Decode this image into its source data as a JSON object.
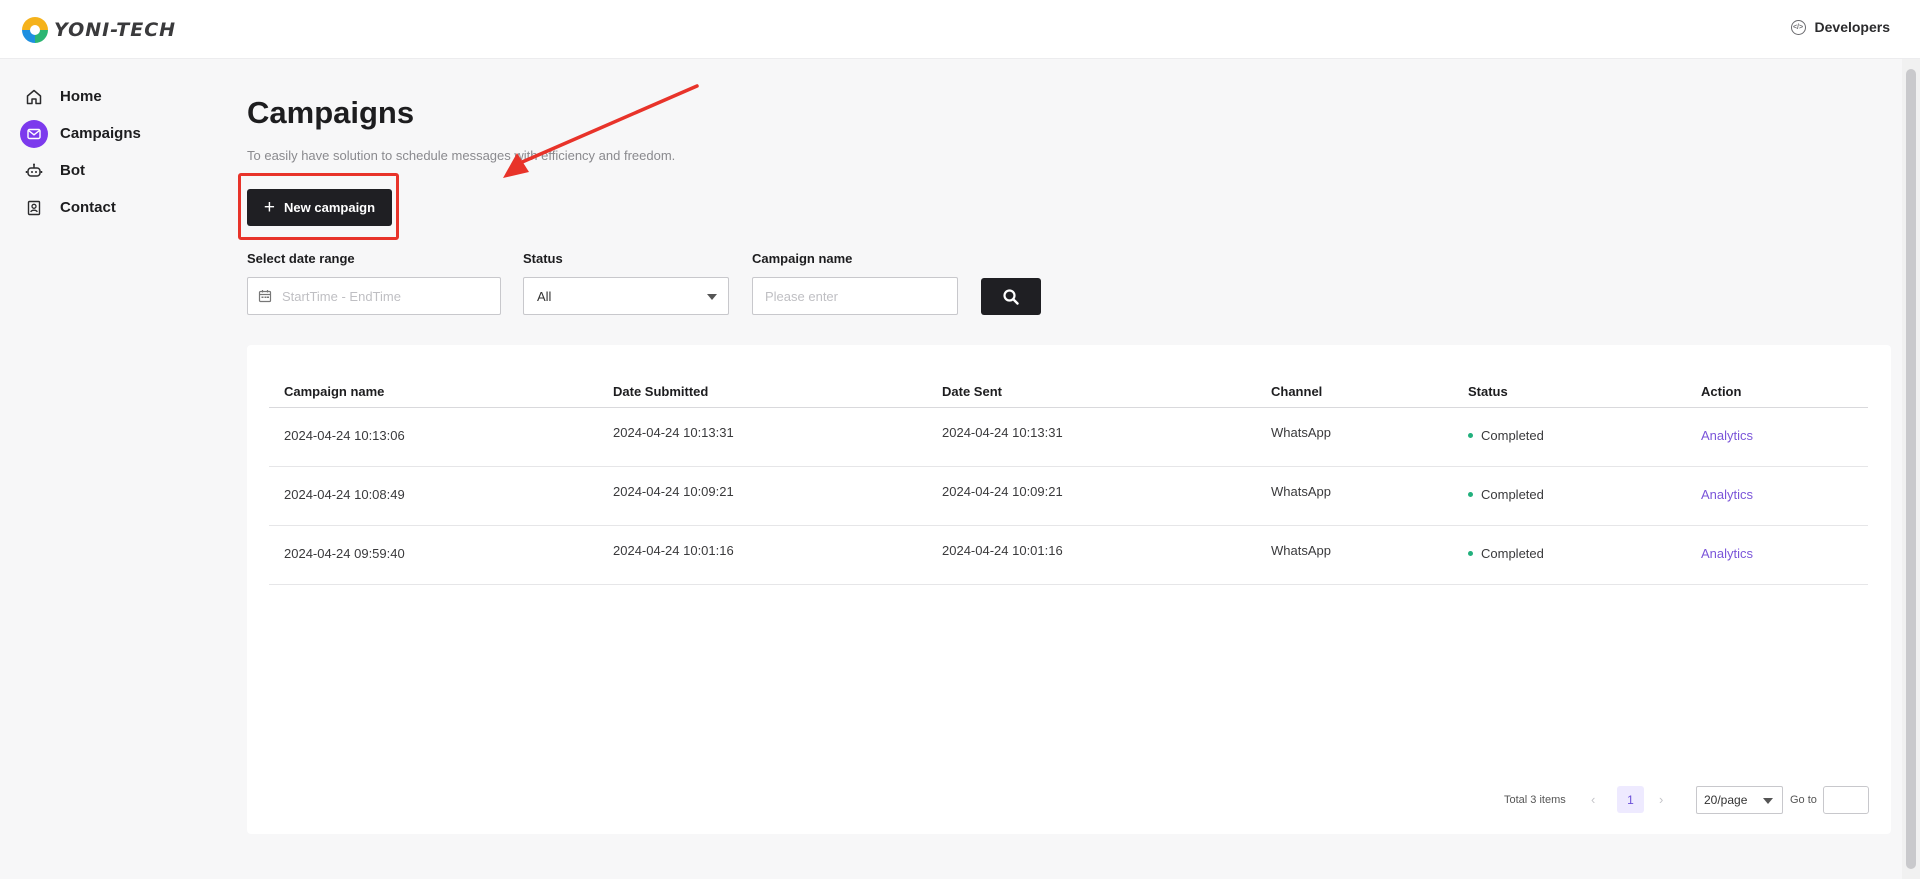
{
  "brand": {
    "name": "YONI-TECH"
  },
  "header": {
    "developers_label": "Developers"
  },
  "sidebar": {
    "items": [
      {
        "label": "Home",
        "icon": "home-icon",
        "active": false
      },
      {
        "label": "Campaigns",
        "icon": "mail-icon",
        "active": true
      },
      {
        "label": "Bot",
        "icon": "robot-icon",
        "active": false
      },
      {
        "label": "Contact",
        "icon": "contact-icon",
        "active": false
      }
    ]
  },
  "page": {
    "title": "Campaigns",
    "subtitle": "To easily have solution to schedule messages with efficiency and freedom.",
    "new_button_label": "New campaign"
  },
  "filters": {
    "date_label": "Select date range",
    "date_placeholder": "StartTime - EndTime",
    "status_label": "Status",
    "status_value": "All",
    "name_label": "Campaign name",
    "name_placeholder": "Please enter"
  },
  "table": {
    "columns": [
      "Campaign name",
      "Date Submitted",
      "Date Sent",
      "Channel",
      "Status",
      "Action"
    ],
    "rows": [
      {
        "name": "2024-04-24 10:13:06",
        "submitted": "2024-04-24 10:13:31",
        "sent": "2024-04-24 10:13:31",
        "channel": "WhatsApp",
        "status": "Completed",
        "action": "Analytics"
      },
      {
        "name": "2024-04-24 10:08:49",
        "submitted": "2024-04-24 10:09:21",
        "sent": "2024-04-24 10:09:21",
        "channel": "WhatsApp",
        "status": "Completed",
        "action": "Analytics"
      },
      {
        "name": "2024-04-24 09:59:40",
        "submitted": "2024-04-24 10:01:16",
        "sent": "2024-04-24 10:01:16",
        "channel": "WhatsApp",
        "status": "Completed",
        "action": "Analytics"
      }
    ]
  },
  "pagination": {
    "total_label": "Total 3 items",
    "current_page": "1",
    "page_size": "20/page",
    "goto_label": "Go to"
  },
  "colors": {
    "accent": "#7c3aed",
    "status_completed": "#22b07d",
    "link": "#7b55d9",
    "annotation": "#e8332a"
  }
}
